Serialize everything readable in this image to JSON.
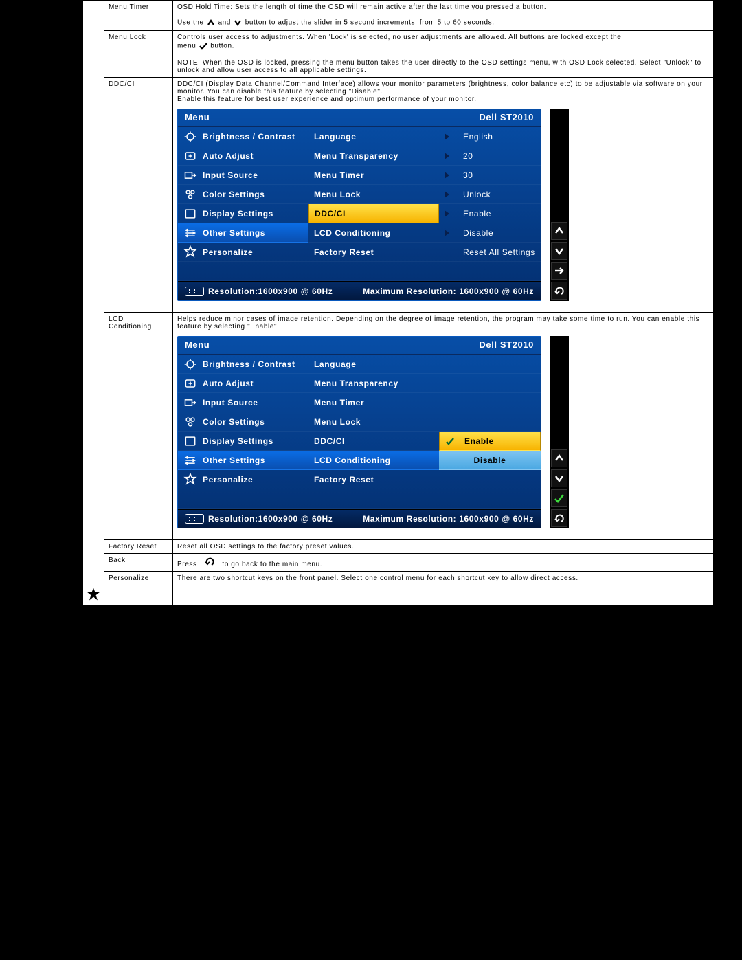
{
  "rows": {
    "menu_timer": {
      "label": "Menu Timer",
      "line1": "OSD Hold Time: Sets the length of time the OSD will remain active after the last time you pressed a button.",
      "line2a": "Use the",
      "line2b": "and",
      "line2c": "button to adjust the slider in 5 second increments, from 5 to 60 seconds."
    },
    "menu_lock": {
      "label": "Menu Lock",
      "line1": "Controls user access to adjustments. When 'Lock' is selected, no user adjustments are allowed. All buttons are locked except the",
      "line1b": "menu",
      "line1c": "button.",
      "note": "NOTE: When the OSD is locked, pressing the menu button takes the user directly to the OSD settings menu, with OSD Lock selected. Select \"Unlock\" to unlock and allow user access to all applicable settings."
    },
    "ddcci": {
      "label": "DDC/CI",
      "line1": "DDC/CI (Display Data Channel/Command Interface) allows your monitor parameters (brightness, color balance etc) to be adjustable via software on your monitor. You can disable this feature by selecting \"Disable\".",
      "line2": "Enable this feature for best user experience and optimum performance of your monitor."
    },
    "lcd": {
      "label": "LCD Conditioning",
      "line1": "Helps reduce minor cases of image retention. Depending on the degree of image retention, the program may take some time to run. You can enable this feature by selecting \"Enable\"."
    },
    "factory": {
      "label": "Factory Reset",
      "text": "Reset all OSD settings to the factory preset values."
    },
    "back": {
      "label": "Back",
      "press": "Press",
      "text": "to go back to the main menu."
    },
    "personalize": {
      "label": "Personalize",
      "text": "There are two shortcut keys on the front panel. Select one control menu for each shortcut key to allow direct access."
    }
  },
  "osd": {
    "menu_title": "Menu",
    "model": "Dell ST2010",
    "left_items": [
      "Brightness / Contrast",
      "Auto Adjust",
      "Input Source",
      "Color Settings",
      "Display Settings",
      "Other Settings",
      "Personalize"
    ],
    "mid_items": [
      "Language",
      "Menu Transparency",
      "Menu Timer",
      "Menu Lock",
      "DDC/CI",
      "LCD Conditioning",
      "Factory Reset"
    ],
    "res_label": "Resolution:1600x900 @ 60Hz",
    "max_res": "Maximum Resolution: 1600x900 @ 60Hz"
  },
  "osd1": {
    "right": [
      {
        "arrow": true,
        "value": "English"
      },
      {
        "arrow": true,
        "value": "20"
      },
      {
        "arrow": true,
        "value": "30"
      },
      {
        "arrow": true,
        "value": "Unlock"
      },
      {
        "arrow": true,
        "value": "Enable"
      },
      {
        "arrow": true,
        "value": "Disable"
      },
      {
        "arrow": false,
        "value": "Reset All Settings"
      }
    ],
    "buttons": [
      "up",
      "down",
      "right",
      "back"
    ]
  },
  "osd2": {
    "right_options": {
      "enable": "Enable",
      "disable": "Disable"
    },
    "buttons": [
      "up",
      "down",
      "check",
      "back"
    ]
  }
}
